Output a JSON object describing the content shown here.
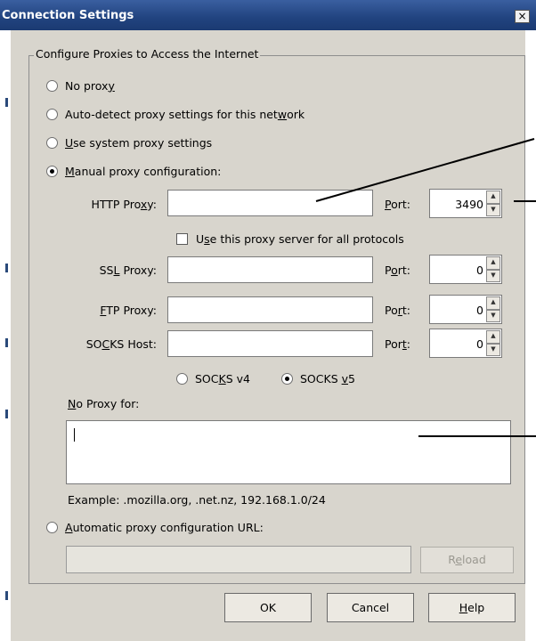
{
  "window": {
    "title": "Connection Settings",
    "close_label": "×"
  },
  "group": {
    "legend": "Configure Proxies to Access the Internet"
  },
  "radios": {
    "no_proxy": {
      "pre": "No prox",
      "u": "y",
      "post": "",
      "checked": false
    },
    "auto_detect": {
      "pre": "Auto-detect proxy settings for this net",
      "u": "w",
      "post": "ork",
      "checked": false
    },
    "system": {
      "pre": "",
      "u": "U",
      "post": "se system proxy settings",
      "checked": false
    },
    "manual": {
      "pre": "",
      "u": "M",
      "post": "anual proxy configuration:",
      "checked": true
    }
  },
  "http": {
    "label_pre": "HTTP Pro",
    "label_u": "x",
    "label_post": "y:",
    "value": "",
    "port_label_pre": "",
    "port_label_u": "P",
    "port_label_post": "ort:",
    "port_value": "3490"
  },
  "all_protocols": {
    "pre": "U",
    "u": "s",
    "post": "e this proxy server for all protocols",
    "checked": false
  },
  "ssl": {
    "label_pre": "SS",
    "label_u": "L",
    "label_post": " Proxy:",
    "value": "",
    "port_label_pre": "P",
    "port_label_u": "o",
    "port_label_post": "rt:",
    "port_value": "0"
  },
  "ftp": {
    "label_pre": "",
    "label_u": "F",
    "label_post": "TP Proxy:",
    "value": "",
    "port_label_pre": "Po",
    "port_label_u": "r",
    "port_label_post": "t:",
    "port_value": "0"
  },
  "socks": {
    "label_pre": "SO",
    "label_u": "C",
    "label_post": "KS Host:",
    "value": "",
    "port_label_pre": "Por",
    "port_label_u": "t",
    "port_label_post": ":",
    "port_value": "0"
  },
  "socks_version": {
    "v4": {
      "pre": "SOC",
      "u": "K",
      "post": "S v4",
      "checked": false
    },
    "v5": {
      "pre": "SOCKS ",
      "u": "v",
      "post": "5",
      "checked": true
    }
  },
  "no_proxy_for": {
    "label_pre": "",
    "label_u": "N",
    "label_post": "o Proxy for:",
    "value": ""
  },
  "example": "Example: .mozilla.org, .net.nz, 192.168.1.0/24",
  "autoconfig": {
    "pre": "",
    "u": "A",
    "post": "utomatic proxy configuration URL:",
    "checked": false,
    "value": ""
  },
  "reload": {
    "pre": "R",
    "u": "e",
    "post": "load"
  },
  "buttons": {
    "ok": "OK",
    "cancel": "Cancel",
    "help": {
      "pre": "",
      "u": "H",
      "post": "elp"
    }
  },
  "colors": {
    "titlebar": "#21437f",
    "dialog_bg": "#d8d5cd"
  },
  "icons": {
    "spin_up": "▲",
    "spin_down": "▼"
  }
}
